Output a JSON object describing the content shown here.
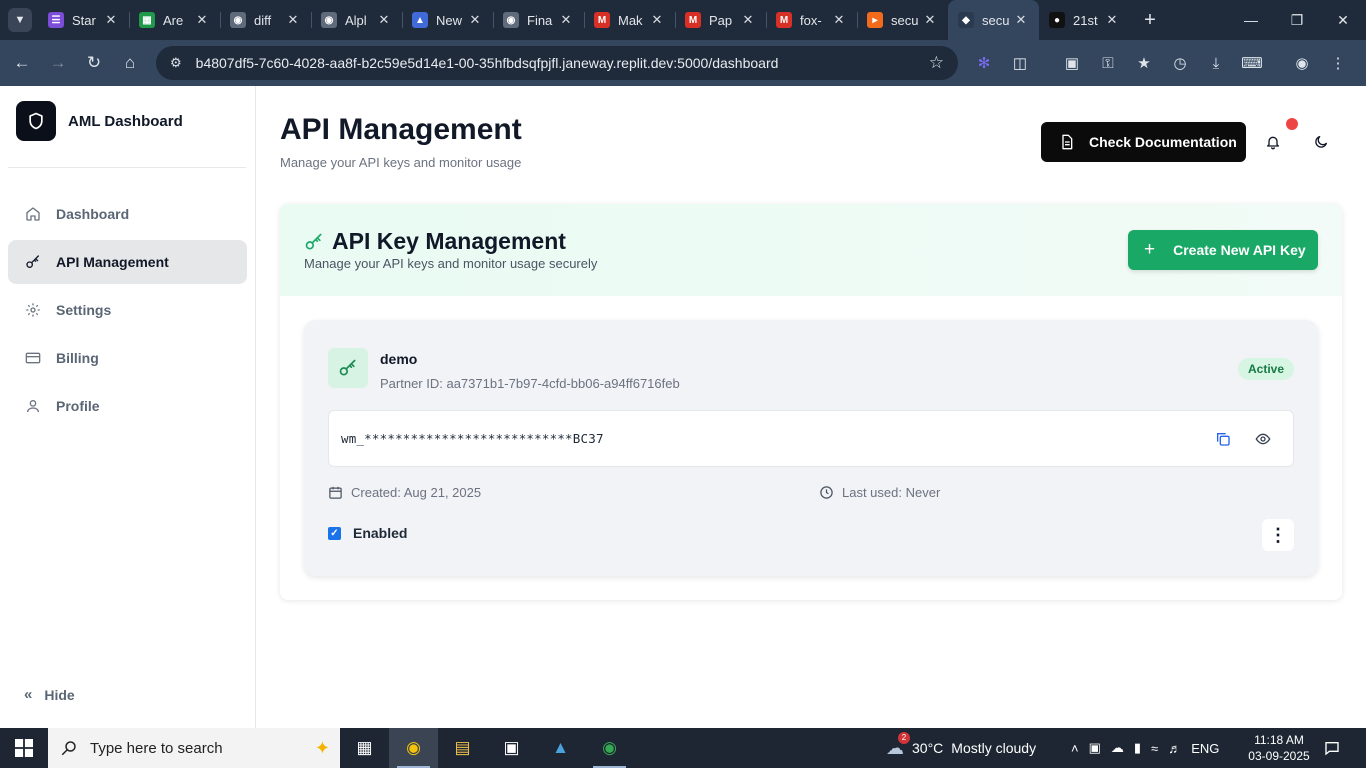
{
  "browser": {
    "tabs": [
      {
        "title": "Star",
        "icon": "list-icon",
        "color": "#7b4dd8"
      },
      {
        "title": "Are",
        "icon": "sheets-icon",
        "color": "#1e9a4a"
      },
      {
        "title": "diff",
        "icon": "globe-icon",
        "color": "#5f6b7a"
      },
      {
        "title": "Alpl",
        "icon": "globe-icon",
        "color": "#5f6b7a"
      },
      {
        "title": "New",
        "icon": "replit-icon",
        "color": "#3f6ad8"
      },
      {
        "title": "Fina",
        "icon": "globe-icon",
        "color": "#5f6b7a"
      },
      {
        "title": "Mak",
        "icon": "gmail-icon",
        "color": "#d93025"
      },
      {
        "title": "Pap",
        "icon": "gmail-icon",
        "color": "#d93025"
      },
      {
        "title": "fox-",
        "icon": "gmail-icon",
        "color": "#d93025"
      },
      {
        "title": "secu",
        "icon": "orange-icon",
        "color": "#f26a1b"
      },
      {
        "title": "secu",
        "icon": "app-icon",
        "color": "#2a3a50"
      },
      {
        "title": "21st",
        "icon": "dark-icon",
        "color": "#111111"
      }
    ],
    "active_tab_index": 10,
    "url": "b4807df5-7c60-4028-aa8f-b2c59e5d14e1-00-35hfbdsqfpjfl.janeway.replit.dev:5000/dashboard"
  },
  "sidebar": {
    "brand": "AML Dashboard",
    "items": [
      {
        "label": "Dashboard",
        "icon": "home-icon"
      },
      {
        "label": "API Management",
        "icon": "key-icon",
        "active": true
      },
      {
        "label": "Settings",
        "icon": "gear-icon"
      },
      {
        "label": "Billing",
        "icon": "card-icon"
      },
      {
        "label": "Profile",
        "icon": "user-icon"
      }
    ],
    "hide_label": "Hide"
  },
  "header": {
    "title": "API Management",
    "subtitle": "Manage your API keys and monitor usage",
    "doc_button": "Check Documentation"
  },
  "panel": {
    "title": "API Key Management",
    "subtitle": "Manage your API keys and monitor usage securely",
    "create_button": "Create New API Key"
  },
  "key": {
    "name": "demo",
    "partner_id": "Partner ID: aa7371b1-7b97-4cfd-bb06-a94ff6716feb",
    "status": "Active",
    "masked_value": "wm_***************************BC37",
    "created": "Created: Aug 21, 2025",
    "last_used": "Last used: Never",
    "enabled_label": "Enabled",
    "enabled": true
  },
  "colors": {
    "accent_green": "#1aa866",
    "badge_green": "#167a44",
    "notification_dot": "#ef4444"
  },
  "taskbar": {
    "search_placeholder": "Type here to search",
    "weather_temp": "30°C",
    "weather_text": "Mostly cloudy",
    "weather_badge": "2",
    "language": "ENG",
    "time": "11:18 AM",
    "date": "03-09-2025"
  }
}
